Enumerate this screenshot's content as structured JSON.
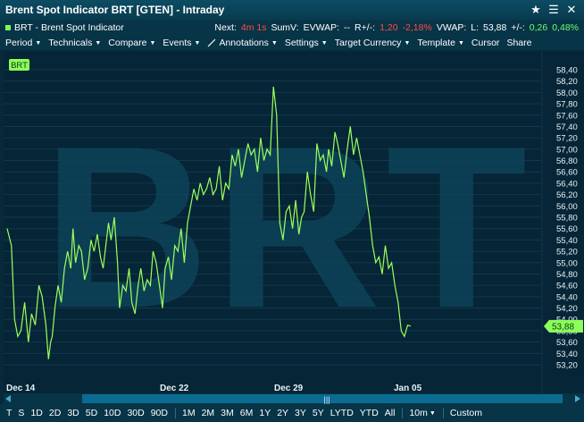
{
  "window": {
    "title": "Brent Spot Indicator BRT [GTEN] - Intraday",
    "controls": [
      "★",
      "☰",
      "✕"
    ]
  },
  "infobar": {
    "instrument": "BRT - Brent Spot Indicator",
    "next_label": "Next:",
    "next_value": "4m 1s",
    "sumv_label": "SumV:",
    "evwap_label": "EVWAP:",
    "evwap_value": "--",
    "r_label": "R+/-:",
    "r_value": "1,20",
    "r_pct": "-2,18%",
    "vwap_label": "VWAP:",
    "last_label": "L:",
    "last_value": "53,88",
    "chg_label": "+/-:",
    "chg_value": "0,26",
    "chg_pct": "0,48%"
  },
  "menu": [
    {
      "label": "Period",
      "caret": true
    },
    {
      "label": "Technicals",
      "caret": true
    },
    {
      "label": "Compare",
      "caret": true
    },
    {
      "label": "Events",
      "caret": true
    },
    {
      "label": "Annotations",
      "caret": true
    },
    {
      "label": "Settings",
      "caret": true
    },
    {
      "label": "Target Currency",
      "caret": true
    },
    {
      "label": "Template",
      "caret": true
    },
    {
      "label": "Cursor",
      "caret": false
    },
    {
      "label": "Share",
      "caret": false
    }
  ],
  "chart": {
    "badge": "BRT",
    "watermark": "BRT",
    "last_price_label": "53,88",
    "scroll_grip": "|||"
  },
  "chart_data": {
    "type": "line",
    "series": [
      {
        "name": "BRT",
        "color": "#9cff5c"
      }
    ],
    "y_ticks": [
      "58,40",
      "58,20",
      "58,00",
      "57,80",
      "57,60",
      "57,40",
      "57,20",
      "57,00",
      "56,80",
      "56,60",
      "56,40",
      "56,20",
      "56,00",
      "55,80",
      "55,60",
      "55,40",
      "55,20",
      "55,00",
      "54,80",
      "54,60",
      "54,40",
      "54,20",
      "54,00",
      "53,80",
      "53,60",
      "53,40",
      "53,20"
    ],
    "ylim": [
      53.2,
      58.4
    ],
    "x_ticks": [
      "Dec 14",
      "Dec 22",
      "Dec 29",
      "Jan 05"
    ],
    "x": [
      0,
      0.8,
      1.4,
      2.0,
      2.6,
      3.3,
      4.0,
      4.6,
      5.3,
      6.0,
      6.6,
      7.3,
      7.8,
      8.2,
      8.5,
      9.0,
      9.6,
      10.2,
      10.8,
      11.4,
      12.0,
      12.4,
      12.9,
      13.5,
      14.0,
      14.6,
      15.2,
      15.8,
      16.4,
      17.0,
      17.6,
      18.1,
      18.6,
      19.1,
      19.6,
      20.2,
      20.8,
      21.2,
      21.8,
      22.4,
      23.0,
      23.5,
      24.1,
      24.7,
      25.2,
      25.8,
      26.4,
      27.0,
      27.5,
      28.1,
      28.7,
      29.3,
      29.8,
      30.4,
      31.0,
      31.6,
      32.2,
      32.8,
      33.4,
      34.0,
      34.6,
      35.2,
      35.8,
      36.4,
      37.0,
      37.6,
      38.2,
      38.8,
      39.4,
      40.0,
      40.6,
      41.2,
      41.8,
      42.4,
      43.0,
      43.6,
      44.2,
      44.8,
      45.4,
      46.0,
      46.6,
      47.2,
      47.8,
      48.4,
      49.0,
      49.6,
      50.2,
      50.8,
      51.4,
      52.0,
      52.6,
      53.2,
      53.8,
      54.4,
      55.0,
      55.5,
      56.0,
      56.6,
      57.2,
      57.8,
      58.4,
      59.0,
      59.6,
      60.2,
      60.6,
      61.2,
      61.8,
      62.3,
      62.9,
      63.5,
      64.1,
      64.7,
      65.3,
      65.9,
      66.5,
      67.1,
      67.7,
      68.3,
      68.9,
      69.5,
      70.1,
      70.7,
      71.3,
      71.9,
      72.5,
      73.1,
      73.7,
      74.3,
      74.9,
      75.5,
      76.1,
      76.7,
      77.3,
      77.9,
      78.5,
      79.1,
      79.7,
      80.3,
      80.9,
      81.5,
      82.1,
      82.7,
      83.3,
      83.9,
      84.5,
      85.1,
      85.7,
      86.3,
      86.9,
      87.5,
      88.1,
      88.7,
      89.3,
      89.9,
      90.5,
      91.1,
      91.7,
      92.3,
      92.9,
      93.5,
      94.1,
      94.7,
      95.3,
      95.9,
      96.5,
      97.1,
      97.7,
      98.3,
      98.9,
      99.5,
      100
    ],
    "y": [
      55.6,
      55.3,
      54.0,
      53.7,
      53.8,
      54.3,
      53.6,
      54.1,
      53.9,
      54.6,
      54.4,
      53.9,
      53.3,
      53.6,
      53.7,
      54.2,
      54.6,
      54.3,
      54.9,
      55.2,
      54.9,
      55.6,
      55.0,
      55.3,
      55.2,
      54.7,
      54.9,
      55.4,
      55.2,
      55.5,
      55.1,
      54.9,
      55.3,
      55.7,
      55.4,
      55.8,
      55.0,
      54.2,
      54.6,
      54.5,
      54.9,
      54.3,
      54.1,
      54.6,
      54.9,
      54.5,
      54.7,
      54.6,
      55.2,
      55.0,
      54.6,
      54.2,
      54.9,
      55.1,
      54.7,
      55.3,
      55.2,
      55.6,
      55.0,
      55.7,
      56.0,
      56.3,
      56.1,
      56.4,
      56.2,
      56.3,
      56.5,
      56.2,
      56.3,
      56.7,
      56.1,
      56.4,
      56.3,
      56.9,
      56.7,
      57.0,
      56.5,
      56.8,
      57.1,
      56.9,
      57.0,
      56.6,
      57.2,
      56.8,
      57.0,
      56.9,
      58.1,
      57.6,
      55.7,
      55.4,
      55.9,
      56.0,
      55.6,
      56.1,
      55.5,
      55.8,
      55.9,
      56.6,
      56.2,
      55.9,
      57.1,
      56.8,
      56.9,
      56.6,
      57.0,
      56.7,
      57.3,
      57.1,
      56.8,
      56.5,
      57.0,
      57.4,
      56.9,
      57.2,
      56.9,
      56.6,
      56.2,
      55.8,
      55.3,
      55.0,
      55.1,
      54.8,
      55.3,
      54.9,
      55.0,
      54.6,
      54.3,
      53.8,
      53.7,
      53.9,
      53.88
    ]
  },
  "bottom": {
    "periods": [
      "T",
      "S",
      "1D",
      "2D",
      "3D",
      "5D",
      "10D",
      "30D",
      "90D"
    ],
    "ranges": [
      "1M",
      "2M",
      "3M",
      "6M",
      "1Y",
      "2Y",
      "3Y",
      "5Y",
      "LYTD",
      "YTD",
      "All"
    ],
    "interval": "10m",
    "custom": "Custom"
  }
}
